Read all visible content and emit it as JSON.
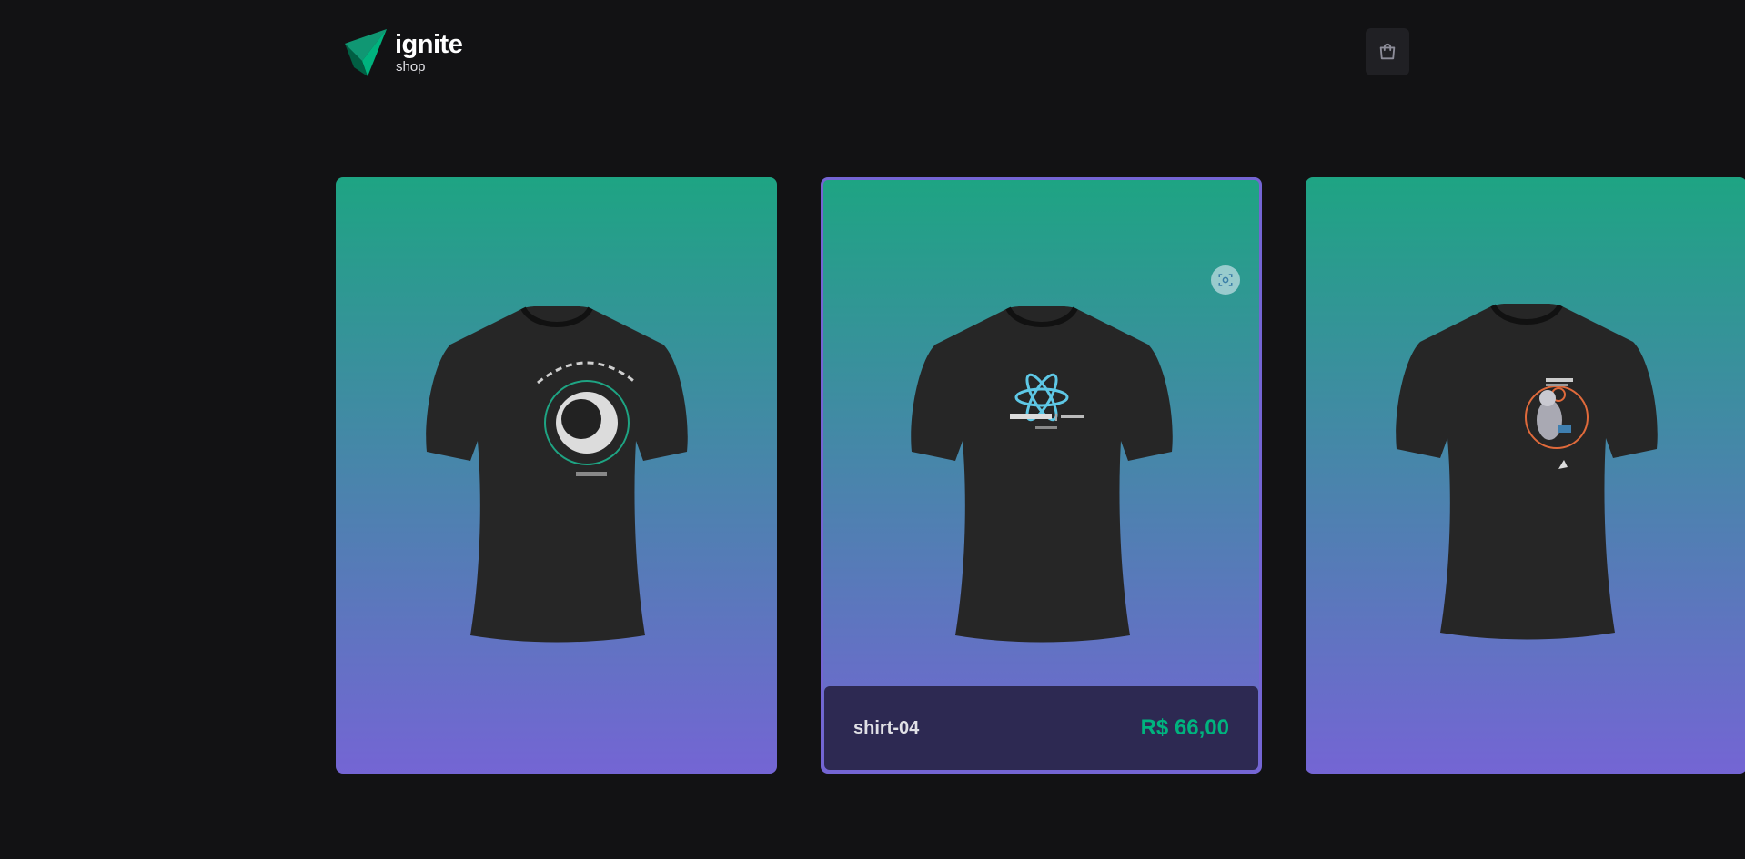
{
  "header": {
    "logo_title": "ignite",
    "logo_subtitle": "shop",
    "cart_icon": "shopping-bag-icon"
  },
  "products": [
    {
      "print": "IGNITER ABOARD astronaut print",
      "accent": "#1ea483"
    },
    {
      "name": "shirt-04",
      "price": "R$ 66,00",
      "print": "ignite lab | REACTJS print",
      "accent": "#5ec8e6"
    },
    {
      "print": "MARATONA EXPLORER astronaut print",
      "accent": "#e06a3b"
    }
  ],
  "colors": {
    "background": "#121214",
    "gradient_top": "#1ea483",
    "gradient_bottom": "#7465d4",
    "footer": "#2d2952",
    "price": "#00b37e"
  }
}
